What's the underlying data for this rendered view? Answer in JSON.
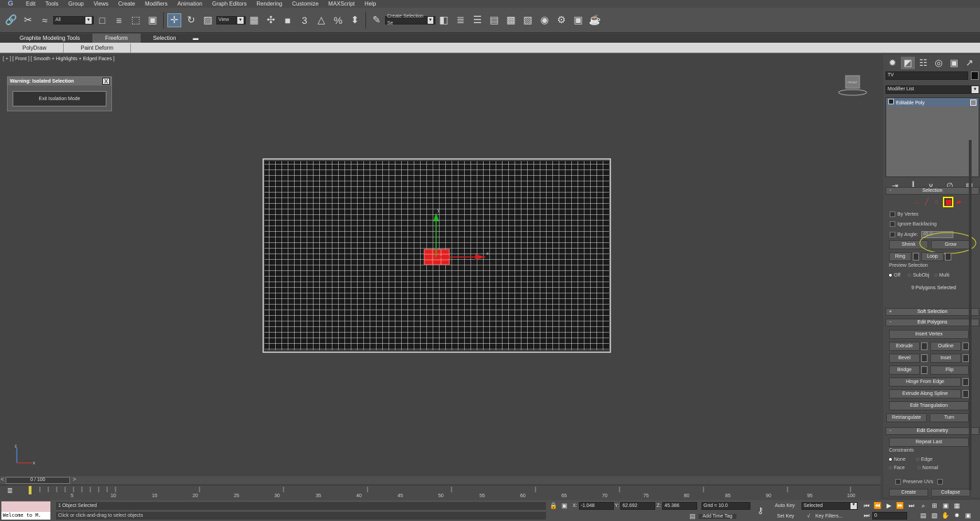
{
  "menu": {
    "logo": "G",
    "items": [
      "Edit",
      "Tools",
      "Group",
      "Views",
      "Create",
      "Modifiers",
      "Animation",
      "Graph Editors",
      "Rendering",
      "Customize",
      "MAXScript",
      "Help"
    ]
  },
  "toolbar": {
    "filter_value": "All",
    "ref_coord_value": "View",
    "named_sel_value": "Create Selection Se",
    "snap_3": "3",
    "snap_pct": "%"
  },
  "ribbon": {
    "tabs": [
      "Graphite Modeling Tools",
      "Freeform",
      "Selection"
    ],
    "active_tab": "Freeform",
    "subtabs": [
      "PolyDraw",
      "Paint Deform"
    ]
  },
  "viewport": {
    "label": "[ + ] [ Front ] [ Smooth + Highlights + Edged Faces ]",
    "iso_title": "Warning: Isolated Selection",
    "iso_close": "X",
    "iso_button": "Exit Isolation Mode",
    "viewcube_label": "FRONT",
    "gizmo_y_label": "y",
    "gizmo_x_label": "x",
    "tripod_z": "z",
    "tripod_x": "x"
  },
  "command_panel": {
    "object_name": "TV",
    "modifier_list_label": "Modifier List",
    "stack_item": "Editable Poly",
    "selection_rollout": {
      "title": "Selection",
      "by_vertex": "By Vertex",
      "ignore_backfacing": "Ignore Backfacing",
      "by_angle": "By Angle:",
      "by_angle_value": "45.0",
      "shrink": "Shrink",
      "grow": "Grow",
      "ring": "Ring",
      "loop": "Loop",
      "preview_selection": "Preview Selection",
      "preview_off": "Off",
      "preview_subobj": "SubObj",
      "preview_multi": "Multi",
      "status": "9 Polygons Selected"
    },
    "soft_selection_title": "Soft Selection",
    "edit_polygons": {
      "title": "Edit Polygons",
      "insert_vertex": "Insert Vertex",
      "extrude": "Extrude",
      "outline": "Outline",
      "bevel": "Bevel",
      "inset": "Inset",
      "bridge": "Bridge",
      "flip": "Flip",
      "hinge_from_edge": "Hinge From Edge",
      "extrude_along_spline": "Extrude Along Spline",
      "edit_triangulation": "Edit Triangulation",
      "retriangulate": "Retriangulate",
      "turn": "Turn"
    },
    "edit_geometry": {
      "title": "Edit Geometry",
      "repeat_last": "Repeat Last",
      "constraints": "Constraints",
      "none": "None",
      "edge": "Edge",
      "face": "Face",
      "normal": "Normal",
      "preserve_uvs": "Preserve UVs",
      "create": "Create",
      "collapse": "Collapse"
    },
    "collapse_minus": "-",
    "expand_plus": "+"
  },
  "timeline": {
    "frame_display": "0 / 100",
    "prev": "<",
    "next": ">",
    "ticks": [
      "5",
      "10",
      "15",
      "20",
      "25",
      "30",
      "35",
      "40",
      "45",
      "50",
      "55",
      "60",
      "65",
      "70",
      "75",
      "80",
      "85",
      "90",
      "95",
      "100"
    ]
  },
  "status": {
    "listener_text": "Welcome to M.",
    "message1": "1 Object Selected",
    "message2": "Click or click-and-drag to select objects",
    "x_label": "X:",
    "x_value": "-1.048",
    "y_label": "Y:",
    "y_value": "62.692",
    "z_label": "Z:",
    "z_value": "45.386",
    "grid": "Grid = 10.0",
    "add_time_tag": "Add Time Tag",
    "auto_key": "Auto Key",
    "auto_key_mode": "Selected",
    "set_key": "Set Key",
    "key_filters": "Key Filters...",
    "current_frame": "0"
  },
  "colors": {
    "viewport_bg": "#444444",
    "selected_poly": "#e02020",
    "gizmo_y": "#22bb22",
    "gizmo_x": "#d81e1e",
    "highlight_circle": "#d4d42a",
    "polygon_level_active": "#ffee00"
  }
}
